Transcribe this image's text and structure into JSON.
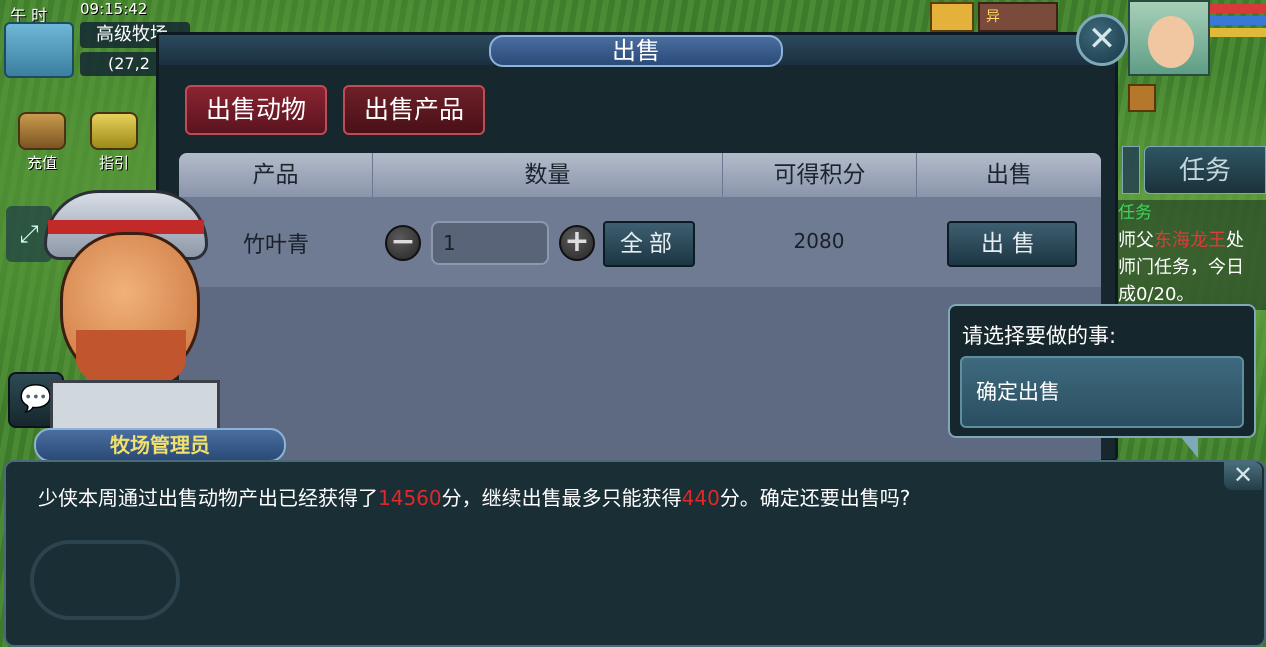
{
  "hud": {
    "time_label": "午 时",
    "clock": "09:15:42",
    "map_name": "高级牧场",
    "coords": "(27,2",
    "recharge_label": "充值",
    "guide_label": "指引",
    "pet_name": "异",
    "task_tab_label": "任务",
    "task_panel": {
      "header": "任务",
      "line1_prefix": "师父",
      "line1_npc": "东海龙王",
      "line1_suffix": "处",
      "line2": "师门任务，今日",
      "line3": "成0/20。"
    }
  },
  "sell_dialog": {
    "title": "出售",
    "tabs": [
      {
        "label": "出售动物",
        "active": true
      },
      {
        "label": "出售产品",
        "active": false
      }
    ],
    "columns": [
      "产品",
      "数量",
      "可得积分",
      "出售"
    ],
    "row": {
      "product": "竹叶青",
      "quantity": "1",
      "all_label": "全部",
      "points": "2080",
      "sell_label": "出售"
    }
  },
  "npc": {
    "name": "牧场管理员"
  },
  "choice": {
    "prompt": "请选择要做的事:",
    "option": "确定出售"
  },
  "message": {
    "part1": "少侠本周通过出售动物产出已经获得了",
    "earned": "14560",
    "part2": "分，继续出售最多只能获得",
    "remaining": "440",
    "part3": "分。确定还要出售吗?"
  },
  "colors": {
    "highlight_red": "#e02828",
    "npc_name_yellow": "#f2e06a",
    "task_green": "#3cd65a"
  },
  "icons": {
    "close_main": "close-icon",
    "close_message": "close-icon",
    "minus": "minus-icon",
    "plus": "plus-icon",
    "chat": "chat-icon",
    "expand": "expand-arrows-icon"
  }
}
